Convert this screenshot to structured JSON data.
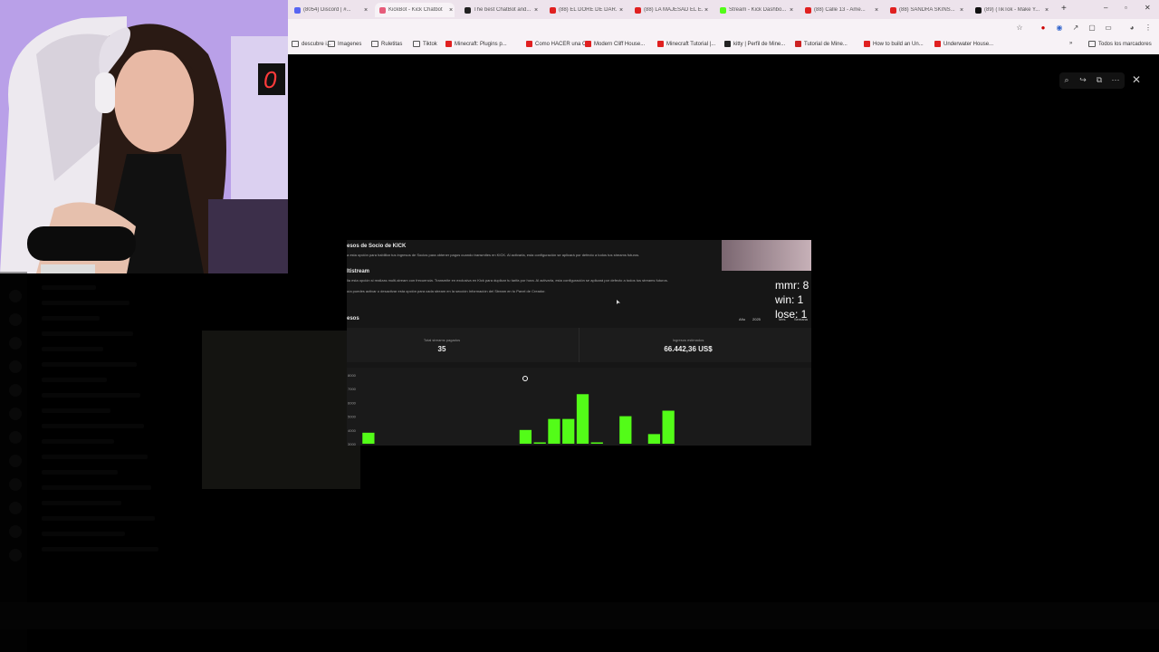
{
  "browser": {
    "tabs": [
      {
        "label": "(8054) Discord | #...",
        "icon": "discord-icon",
        "color": "#5865f2"
      },
      {
        "label": "KickBot - Kick Chatbot",
        "icon": "kick-icon",
        "color": "#e65c7a"
      },
      {
        "label": "The best ChatBot and...",
        "icon": "bot-icon",
        "color": "#222222"
      },
      {
        "label": "(88) EL DORE DE DAR...",
        "icon": "youtube-icon",
        "color": "#e02020"
      },
      {
        "label": "(88) LA MAJESAD EL E...",
        "icon": "youtube-icon",
        "color": "#e02020"
      },
      {
        "label": "Stream - Kick Dashbo...",
        "icon": "kick-icon",
        "color": "#53fc18"
      },
      {
        "label": "(88) Calle 13 - Ame...",
        "icon": "youtube-icon",
        "color": "#e02020"
      },
      {
        "label": "(88) SANDRA SKINS...",
        "icon": "youtube-icon",
        "color": "#e02020"
      },
      {
        "label": "(89) (TikTok - Make Y...",
        "icon": "tiktok-icon",
        "color": "#111111"
      }
    ],
    "new_tab": "+",
    "bookmarks": [
      {
        "label": "descubre i...",
        "icon": "folder"
      },
      {
        "label": "Imagenes",
        "icon": "folder"
      },
      {
        "label": "Ruletitas",
        "icon": "folder"
      },
      {
        "label": "Tiktok",
        "icon": "folder"
      },
      {
        "label": "Minecraft: Plugins p...",
        "icon": "yt"
      },
      {
        "label": "Como HACER una C...",
        "icon": "yt"
      },
      {
        "label": "Modern Cliff House...",
        "icon": "yt"
      },
      {
        "label": "Minecraft Tutorial |...",
        "icon": "yt"
      },
      {
        "label": "kitty | Perfil de Mine...",
        "icon": "dark"
      },
      {
        "label": "Tutorial de Mine...",
        "icon": "red"
      },
      {
        "label": "How to build an Un...",
        "icon": "yt"
      },
      {
        "label": "Underwater House...",
        "icon": "yt"
      }
    ],
    "more_bookmarks": "»",
    "all_bookmarks": "Todos los marcadores"
  },
  "panel": {
    "section1_title": "esos de Socio de KICK",
    "section1_desc": "a esta opción para habilitar tus ingresos de Socios para obtener pagos cuando transmites en KICK. Al activarla, esta configuración se aplicará por defecto a todos tus streams futuros.",
    "section2_title": "ltistream",
    "section2_desc": "lia esta opción si realizas multi-stream con frecuencia. Transmite en exclusiva en Kick para duplicar tu tarifa por hora. Al activarla, esta configuración se aplicará por defecto a todos tus streams futuros.",
    "section2_desc2": "uía puedes activar o desactivar esta opción para cada stream en la sección Información del Stream en tu Panel de Creador.",
    "section3_title": "esos",
    "year_label": "Año",
    "year_value": "2025",
    "filter1": "Mes",
    "filter2": "Semana",
    "stat1_label": "Total streams pagados",
    "stat1_value": "35",
    "stat2_label": "Ingresos estimados",
    "stat2_value": "66.442,36 US$"
  },
  "overlay": {
    "mmr": "mmr: 8",
    "win": "win: 1",
    "lose": "lose: 1"
  },
  "chart_data": {
    "type": "bar",
    "ytick_labels": [
      "8000",
      "7000",
      "6000",
      "5000",
      "4000",
      "3000"
    ],
    "ylim": [
      3000,
      8000
    ],
    "bar_color": "#53fc18",
    "values": [
      3800,
      null,
      null,
      null,
      null,
      null,
      null,
      null,
      null,
      null,
      null,
      4000,
      3100,
      4800,
      4800,
      6600,
      3100,
      null,
      5000,
      null,
      3700,
      5400,
      null,
      null,
      null,
      null,
      null,
      null,
      null,
      null,
      null
    ]
  },
  "colors": {
    "accent": "#53fc18",
    "page_bg": "#000000",
    "panel_bg": "#161616"
  }
}
